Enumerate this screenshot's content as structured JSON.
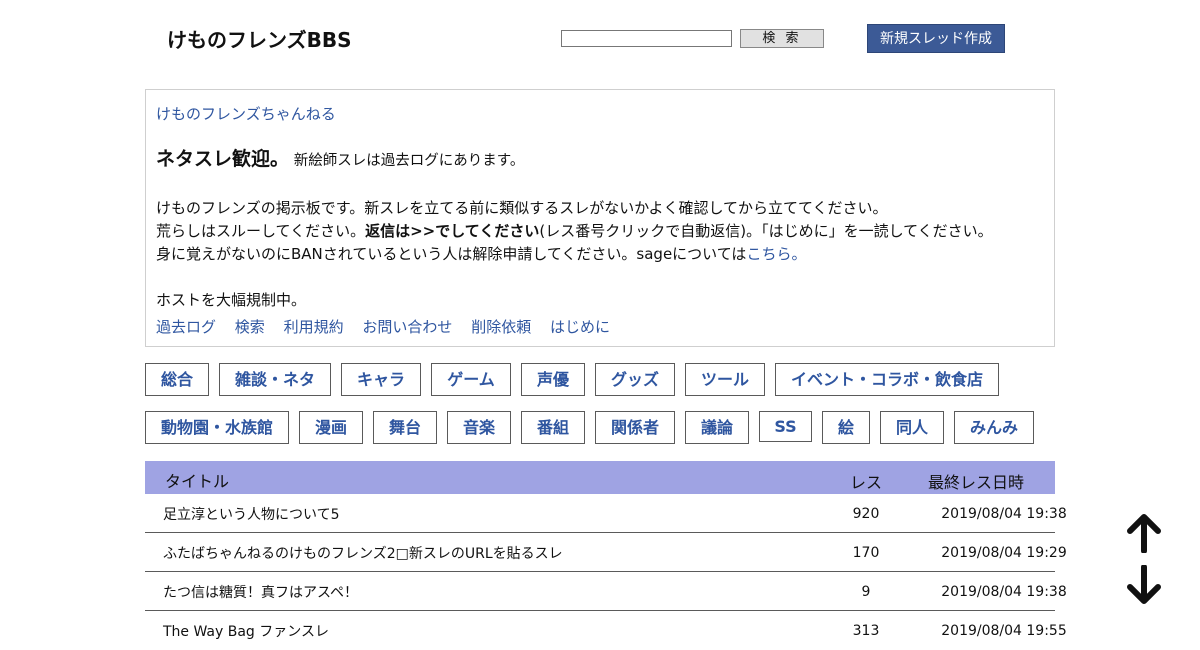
{
  "header": {
    "site_title": "けものフレンズBBS",
    "search_input_value": "",
    "search_button_label": "検 索",
    "new_thread_button_label": "新規スレッド作成"
  },
  "info": {
    "board_link": "けものフレンズちゃんねる",
    "headline_big": "ネタスレ歓迎。",
    "headline_small": "新絵師スレは過去ログにあります。",
    "line1": "けものフレンズの掲示板です。新スレを立てる前に類似するスレがないかよく確認してから立ててください。",
    "line2_a": "荒らしはスルーしてください。",
    "line2_b": "返信は>>でしてください",
    "line2_c": "(レス番号クリックで自動返信)。「はじめに」を一読してください。",
    "line3_a": "身に覚えがないのにBANされているという人は解除申請してください。sageについては",
    "line3_link": "こちら",
    "line3_end": "。",
    "line4": "ホストを大幅規制中。",
    "links": [
      "過去ログ",
      "検索",
      "利用規約",
      "お問い合わせ",
      "削除依頼",
      "はじめに"
    ]
  },
  "categories": [
    [
      "総合",
      "雑談・ネタ",
      "キャラ",
      "ゲーム",
      "声優",
      "グッズ",
      "ツール",
      "イベント・コラボ・飲食店"
    ],
    [
      "動物園・水族館",
      "漫画",
      "舞台",
      "音楽",
      "番組",
      "関係者",
      "議論",
      "SS",
      "絵",
      "同人",
      "みんみ"
    ]
  ],
  "table": {
    "headers": {
      "title": "タイトル",
      "res": "レス",
      "last": "最終レス日時"
    },
    "rows": [
      {
        "title": "足立淳という人物について5",
        "res": "920",
        "date": "2019/08/04 19:38"
      },
      {
        "title": "ふたばちゃんねるのけものフレンズ2□新スレのURLを貼るスレ",
        "res": "170",
        "date": "2019/08/04 19:29"
      },
      {
        "title": "たつ信は糖質！真フはアスペ！",
        "res": "9",
        "date": "2019/08/04 19:38"
      },
      {
        "title": "The Way Bag ファンスレ",
        "res": "313",
        "date": "2019/08/04 19:55"
      }
    ]
  },
  "icons": {
    "scroll_up": "arrow-up-icon",
    "scroll_down": "arrow-down-icon"
  },
  "colors": {
    "accent": "#3c5a96",
    "link": "#2f56a0",
    "table_header": "#9fa3e3"
  }
}
